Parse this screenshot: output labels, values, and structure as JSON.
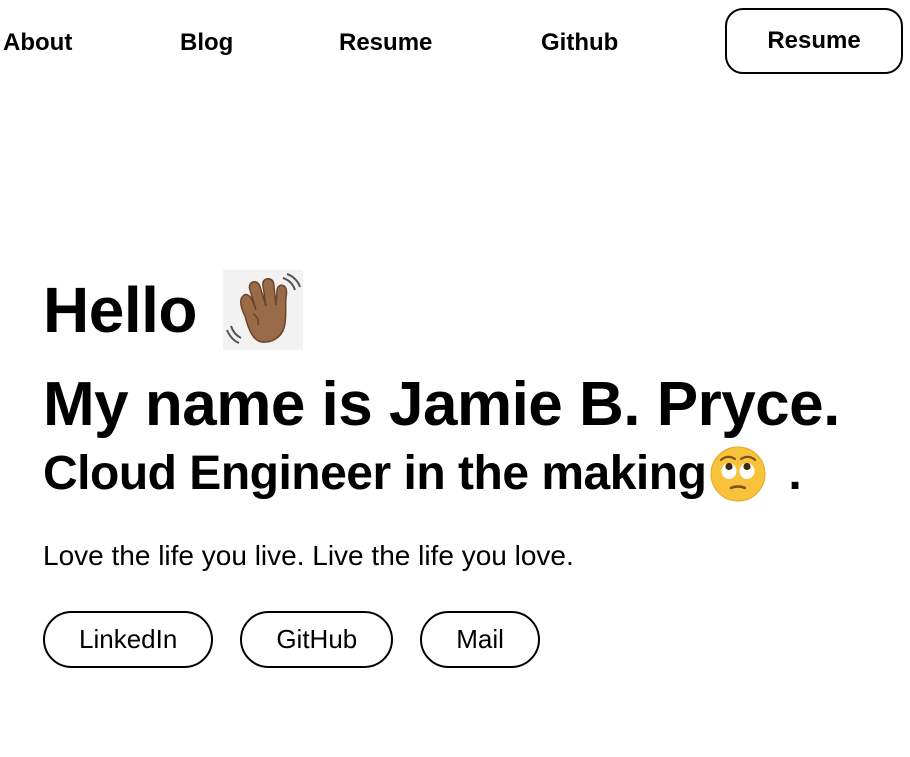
{
  "nav": {
    "links": [
      "About",
      "Blog",
      "Resume",
      "Github"
    ],
    "cta_label": "Resume"
  },
  "hero": {
    "greeting": "Hello",
    "name_line": "My name is Jamie B. Pryce.",
    "tagline": "Cloud Engineer in the making",
    "tagline_suffix": ".",
    "motto": "Love the life you live. Live the life you love.",
    "icons": {
      "greeting": "waving-hand-icon",
      "tagline": "eye-roll-face-icon"
    }
  },
  "socials": {
    "linkedin": "LinkedIn",
    "github": "GitHub",
    "mail": "Mail"
  }
}
